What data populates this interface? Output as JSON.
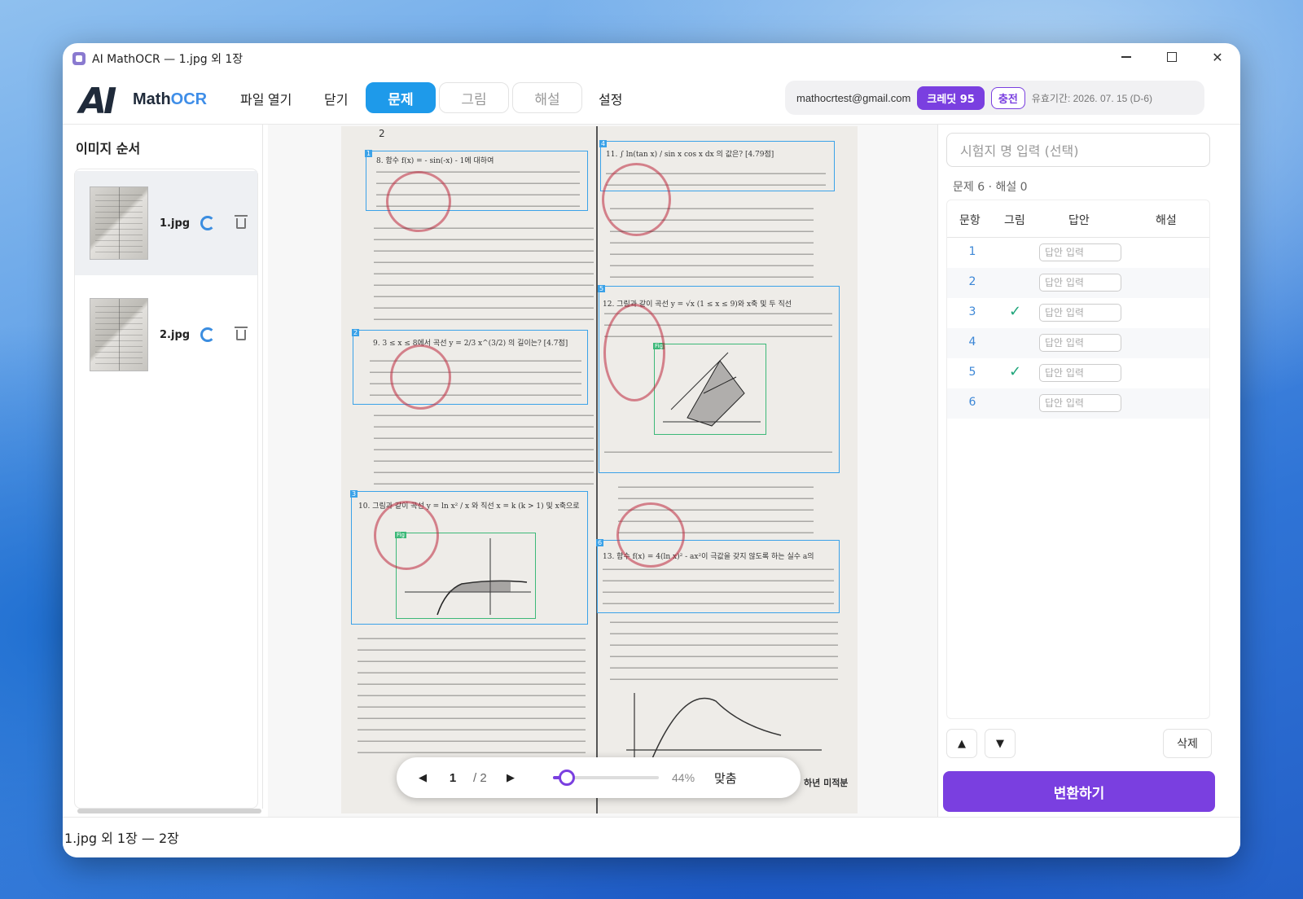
{
  "window": {
    "title": "AI MathOCR — 1.jpg 외 1장"
  },
  "logo": {
    "ai": "AI",
    "text_a": "Math",
    "text_b": "OCR"
  },
  "menu": {
    "open": "파일 열기",
    "close": "닫기",
    "settings": "설정"
  },
  "tabs": [
    {
      "label": "문제",
      "active": true
    },
    {
      "label": "그림",
      "active": false
    },
    {
      "label": "해설",
      "active": false
    }
  ],
  "user": {
    "email": "mathocrtest@gmail.com",
    "credit": "크레딧 95",
    "charge": "충전",
    "expire": "유효기간: 2026. 07. 15 (D-6)"
  },
  "left_panel": {
    "title": "이미지 순서",
    "images": [
      {
        "name": "1.jpg",
        "selected": true
      },
      {
        "name": "2.jpg",
        "selected": false
      }
    ]
  },
  "viewer": {
    "page_top_number": "2",
    "box_labels": [
      "1",
      "2",
      "3",
      "4",
      "5",
      "6"
    ],
    "fig_label": "Fig",
    "question_lines": {
      "q8": "8. 함수 f(x) = - sin(-x) - 1에 대하여",
      "q9": "9. 3 ≤ x ≤ 8에서 곡선 y = 2/3 x^(3/2) 의 길이는? [4.7점]",
      "q10": "10. 그림과 같이 곡선 y = ln x² / x 와 직선 x = k (k > 1) 및 x축으로",
      "q11": "11. ∫ ln(tan x) / sin x cos x dx 의 값은? [4.79점]",
      "q12": "12. 그림과 같이 곡선 y = √x (1 ≤ x ≤ 9)와 x축 및 두 직선",
      "q13": "13. 함수 f(x) = 4(ln x)² - ax²이 극값을 갖지 않도록 하는 실수 a의"
    },
    "footer_text": "하년 미적분",
    "page_current": "1",
    "page_total": "/ 2",
    "zoom_percent": 44,
    "zoom_label": "44%",
    "fit_label": "맞춤",
    "prev_icon": "triangle-left",
    "next_icon": "triangle-right"
  },
  "right_panel": {
    "exam_name_placeholder": "시험지 명 입력 (선택)",
    "counts": "문제 6 · 해설 0",
    "headers": {
      "no": "문항",
      "figure": "그림",
      "answer": "답안",
      "explain": "해설"
    },
    "rows": [
      {
        "no": "1",
        "figure": "",
        "answer_placeholder": "답안 입력"
      },
      {
        "no": "2",
        "figure": "",
        "answer_placeholder": "답안 입력"
      },
      {
        "no": "3",
        "figure": "✓",
        "answer_placeholder": "답안 입력"
      },
      {
        "no": "4",
        "figure": "",
        "answer_placeholder": "답안 입력"
      },
      {
        "no": "5",
        "figure": "✓",
        "answer_placeholder": "답안 입력"
      },
      {
        "no": "6",
        "figure": "",
        "answer_placeholder": "답안 입력"
      }
    ],
    "up": "▲",
    "down": "▼",
    "delete": "삭제",
    "convert": "변환하기"
  },
  "status": {
    "text": "1.jpg 외 1장 — 2장"
  },
  "colors": {
    "primary": "#7a3fe0",
    "tab_active": "#1e9aea",
    "box": "#3ba2e8",
    "fig": "#3cb878",
    "check": "#1ea57a"
  }
}
